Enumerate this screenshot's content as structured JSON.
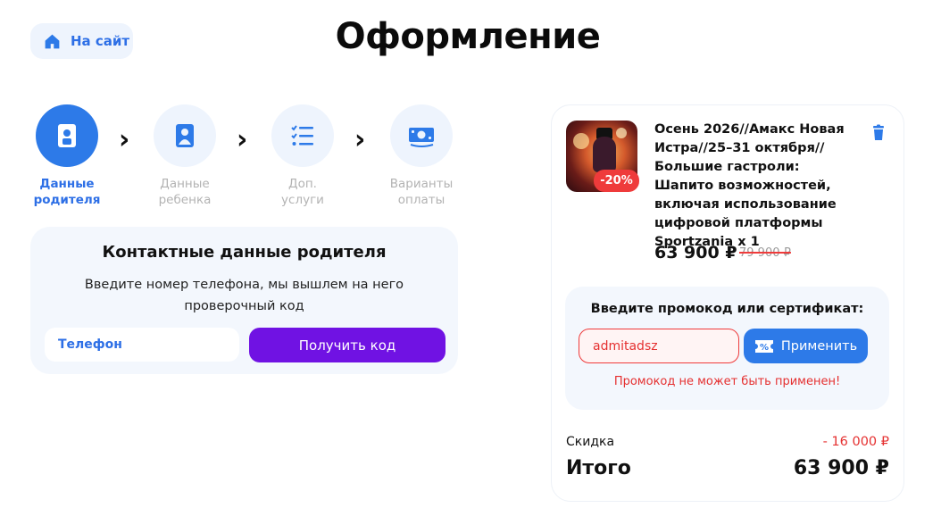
{
  "header": {
    "back_label": "На сайт",
    "title": "Оформление"
  },
  "steps": [
    {
      "label_line1": "Данные",
      "label_line2": "родителя",
      "state": "active",
      "icon": "parent-card-icon"
    },
    {
      "label_line1": "Данные",
      "label_line2": "ребенка",
      "state": "inactive",
      "icon": "child-card-icon"
    },
    {
      "label_line1": "Доп.",
      "label_line2": "услуги",
      "state": "inactive",
      "icon": "checklist-icon"
    },
    {
      "label_line1": "Варианты",
      "label_line2": "оплаты",
      "state": "inactive",
      "icon": "cash-icon"
    }
  ],
  "contact": {
    "title": "Контактные данные родителя",
    "description": "Введите номер телефона, мы вышлем на него проверочный код",
    "phone_placeholder": "Телефон",
    "submit_label": "Получить код"
  },
  "order": {
    "item_title": "Осень 2026//Амакс Новая Истра//25–31 октября// Большие гастроли: Шапито возможностей, включая использование цифровой платформы Sportzania x 1",
    "discount_badge": "-20%",
    "price": "63 900 ₽",
    "old_price": "79 900 ₽",
    "promo": {
      "label": "Введите промокод или сертификат:",
      "value": "admitadsz",
      "apply_label": "Применить",
      "error": "Промокод не может быть применен!"
    },
    "discount_label": "Скидка",
    "discount_value": "- 16 000 ₽",
    "total_label": "Итого",
    "total_value": "63 900 ₽"
  },
  "colors": {
    "accent_blue": "#2d7ae8",
    "accent_purple": "#7012e3",
    "error_red": "#e53030",
    "panel_bg": "#f3f7fd"
  }
}
